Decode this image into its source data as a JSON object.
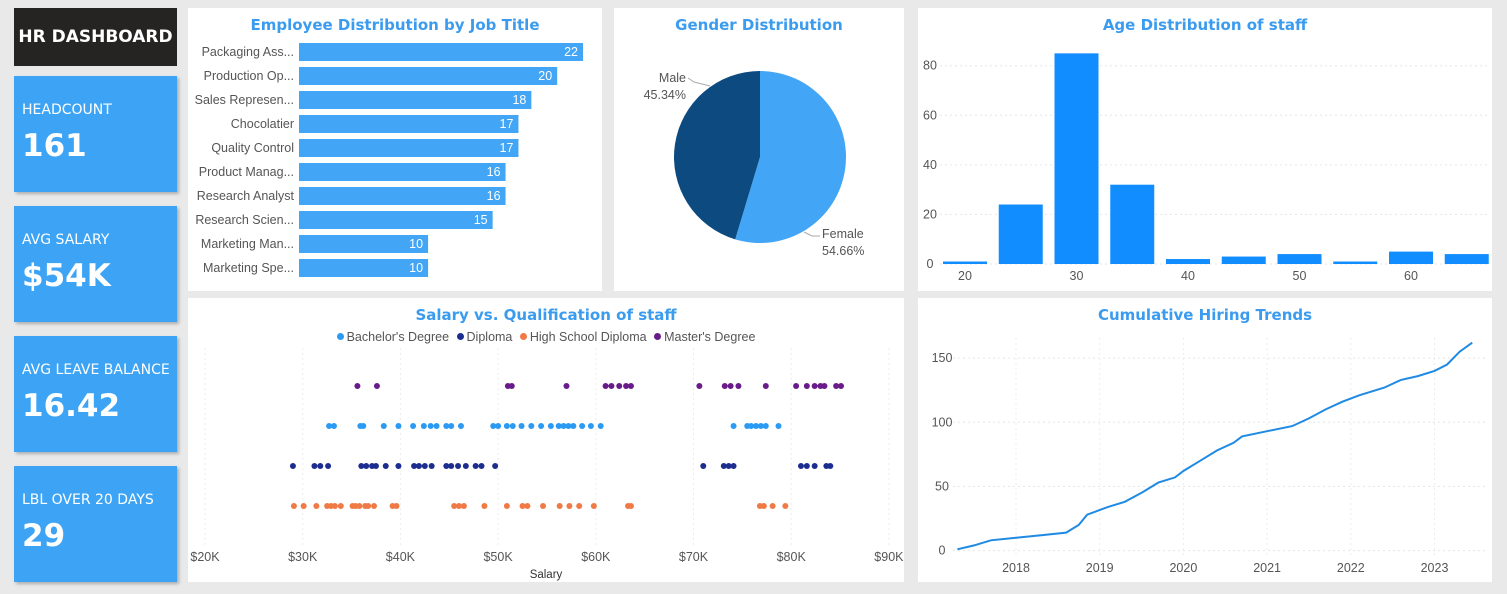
{
  "title": "HR DASHBOARD",
  "kpis": [
    {
      "label": "HEADCOUNT",
      "value": "161"
    },
    {
      "label": "AVG SALARY",
      "value": "$54K"
    },
    {
      "label": "AVG LEAVE BALANCE",
      "value": "16.42"
    },
    {
      "label": "LBL OVER 20 DAYS",
      "value": "29"
    }
  ],
  "colors": {
    "accent": "#3a9bef",
    "bar": "#42a5f5",
    "column": "#118dff",
    "kpi": "#3da4f5"
  },
  "chart_data": [
    {
      "type": "bar",
      "orientation": "horizontal",
      "title": "Employee Distribution by Job Title",
      "categories": [
        "Packaging Ass...",
        "Production Op...",
        "Sales Represen...",
        "Chocolatier",
        "Quality Control",
        "Product Manag...",
        "Research Analyst",
        "Research Scien...",
        "Marketing Man...",
        "Marketing Spe..."
      ],
      "values": [
        22,
        20,
        18,
        17,
        17,
        16,
        16,
        15,
        10,
        10
      ],
      "color": "#42a5f5"
    },
    {
      "type": "pie",
      "title": "Gender Distribution",
      "labels": [
        "Female",
        "Male"
      ],
      "percent_labels": [
        "54.66%",
        "45.34%"
      ],
      "values": [
        54.66,
        45.34
      ],
      "colors": [
        "#42a5f5",
        "#0d4a7f"
      ]
    },
    {
      "type": "bar",
      "title": "Age Distribution of staff",
      "x": [
        20,
        25,
        30,
        35,
        40,
        45,
        50,
        55,
        60,
        65
      ],
      "values": [
        1,
        24,
        85,
        32,
        2,
        3,
        4,
        1,
        5,
        4
      ],
      "xticks": [
        20,
        30,
        40,
        50,
        60
      ],
      "yticks": [
        0,
        20,
        40,
        60,
        80
      ],
      "ylim": [
        0,
        92
      ],
      "color": "#118dff"
    },
    {
      "type": "scatter",
      "title": "Salary vs. Qualification of staff",
      "xlabel": "Salary",
      "xlim": [
        20000,
        90000
      ],
      "xticks": [
        "$20K",
        "$30K",
        "$40K",
        "$50K",
        "$60K",
        "$70K",
        "$80K",
        "$90K"
      ],
      "series": [
        {
          "name": "Bachelor's Degree",
          "color": "#2b9af3",
          "values": [
            32700,
            33200,
            35900,
            36200,
            38300,
            39800,
            41300,
            42400,
            43100,
            43700,
            44700,
            45200,
            46200,
            49500,
            50000,
            50900,
            51500,
            52400,
            53400,
            54400,
            55400,
            56200,
            56700,
            57200,
            57700,
            58600,
            59500,
            60500,
            74100,
            75500,
            75900,
            76400,
            76900,
            77400,
            78700
          ]
        },
        {
          "name": "Diploma",
          "color": "#1d2d8f",
          "values": [
            29000,
            31200,
            31800,
            32600,
            36000,
            36500,
            37100,
            37500,
            38500,
            39800,
            41400,
            41900,
            42500,
            43200,
            44700,
            45200,
            45900,
            46700,
            47700,
            48300,
            49700,
            71000,
            73100,
            73600,
            74100,
            81000,
            81600,
            82400,
            83600,
            84000
          ]
        },
        {
          "name": "High School Diploma",
          "color": "#f07a45",
          "values": [
            29100,
            30100,
            31400,
            32500,
            32900,
            33300,
            33900,
            35100,
            35400,
            35800,
            36400,
            36700,
            37300,
            39200,
            39600,
            45500,
            46000,
            46500,
            48600,
            50900,
            52500,
            53000,
            54600,
            56300,
            57300,
            58300,
            59800,
            63300,
            63600,
            76800,
            77200,
            78100,
            79400
          ]
        },
        {
          "name": "Master's Degree",
          "color": "#6a1b8a",
          "values": [
            35600,
            37600,
            51000,
            51400,
            57000,
            61000,
            61600,
            62400,
            63100,
            63600,
            70600,
            73200,
            73800,
            74600,
            77400,
            80500,
            81600,
            82400,
            83000,
            83400,
            84600,
            85100
          ]
        }
      ]
    },
    {
      "type": "line",
      "title": "Cumulative Hiring Trends",
      "x": [
        2017.3,
        2017.5,
        2017.7,
        2018.0,
        2018.3,
        2018.6,
        2018.75,
        2018.85,
        2019.1,
        2019.3,
        2019.5,
        2019.7,
        2019.9,
        2020.0,
        2020.2,
        2020.4,
        2020.6,
        2020.7,
        2021.0,
        2021.3,
        2021.5,
        2021.7,
        2021.9,
        2022.1,
        2022.4,
        2022.6,
        2022.8,
        2023.0,
        2023.15,
        2023.3,
        2023.45
      ],
      "values": [
        1,
        4,
        8,
        10,
        12,
        14,
        20,
        28,
        34,
        38,
        45,
        53,
        57,
        62,
        70,
        78,
        84,
        89,
        93,
        97,
        103,
        110,
        116,
        121,
        127,
        133,
        136,
        140,
        145,
        155,
        162
      ],
      "xticks": [
        2018,
        2019,
        2020,
        2021,
        2022,
        2023
      ],
      "yticks": [
        0,
        50,
        100,
        150
      ],
      "ylim": [
        -5,
        175
      ],
      "color": "#1f8ae3"
    }
  ]
}
